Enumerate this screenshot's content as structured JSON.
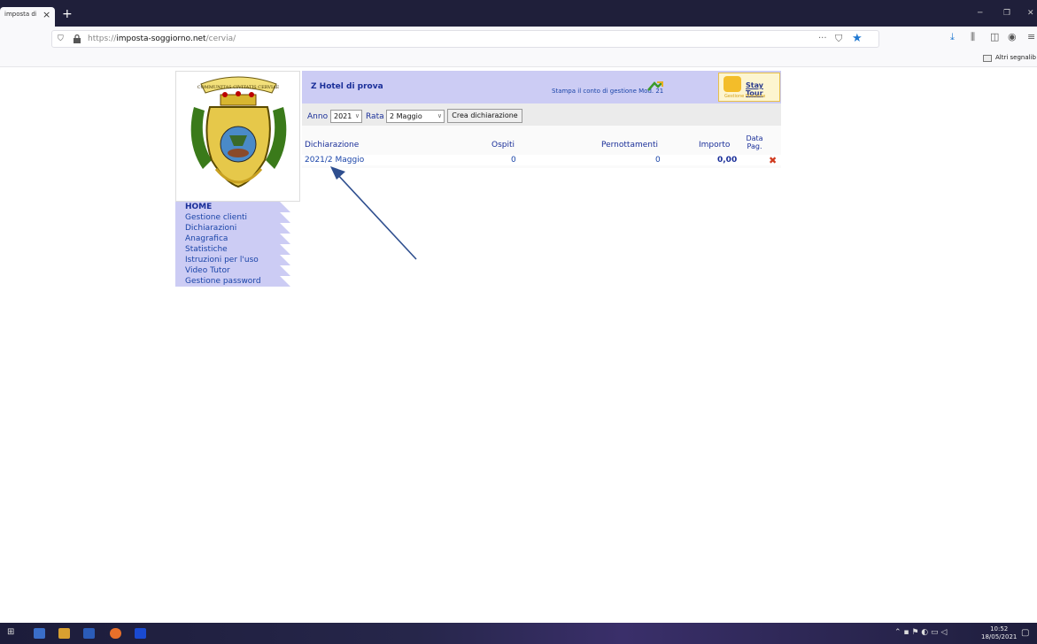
{
  "browser": {
    "tab_title": "imposta di",
    "tab_close": "×",
    "new_tab": "+",
    "url_prefix": "https://",
    "url_host": "imposta-soggiorno.net",
    "url_path": "/cervia/",
    "bookmarks_folder": "Altri segnalib"
  },
  "sidebar": {
    "items": [
      {
        "label": "HOME"
      },
      {
        "label": "Gestione clienti"
      },
      {
        "label": "Dichiarazioni"
      },
      {
        "label": "Anagrafica"
      },
      {
        "label": "Statistiche"
      },
      {
        "label": "Istruzioni per l'uso"
      },
      {
        "label": "Video Tutor"
      },
      {
        "label": "Gestione password"
      }
    ]
  },
  "crest": {
    "motto": "COMMUNITAS CIVITATIS CERVIAE"
  },
  "header": {
    "hotel_name": "Z Hotel di prova",
    "stampa_link": "Stampa il conto di gestione Mod. 21",
    "staytour_title": "Stay Tour",
    "staytour_subtitle": "Gestione Presenze"
  },
  "filters": {
    "anno_label": "Anno",
    "anno_value": "2021",
    "rata_label": "Rata",
    "rata_value": "2 Maggio",
    "crea_button": "Crea dichiarazione"
  },
  "table": {
    "headers": {
      "dichiarazione": "Dichiarazione",
      "ospiti": "Ospiti",
      "pernottamenti": "Pernottamenti",
      "importo": "Importo",
      "data_pag_1": "Data",
      "data_pag_2": "Pag."
    },
    "rows": [
      {
        "dichiarazione": "2021/2 Maggio",
        "ospiti": "0",
        "pernottamenti": "0",
        "importo": "0,00"
      }
    ]
  },
  "taskbar": {
    "time": "10:52",
    "date": "18/05/2021"
  },
  "colors": {
    "accent_blue": "#1a2f99",
    "header_bg": "#ccccf4",
    "menu_bg": "#ccccf4",
    "delete_red": "#d03a1e"
  }
}
